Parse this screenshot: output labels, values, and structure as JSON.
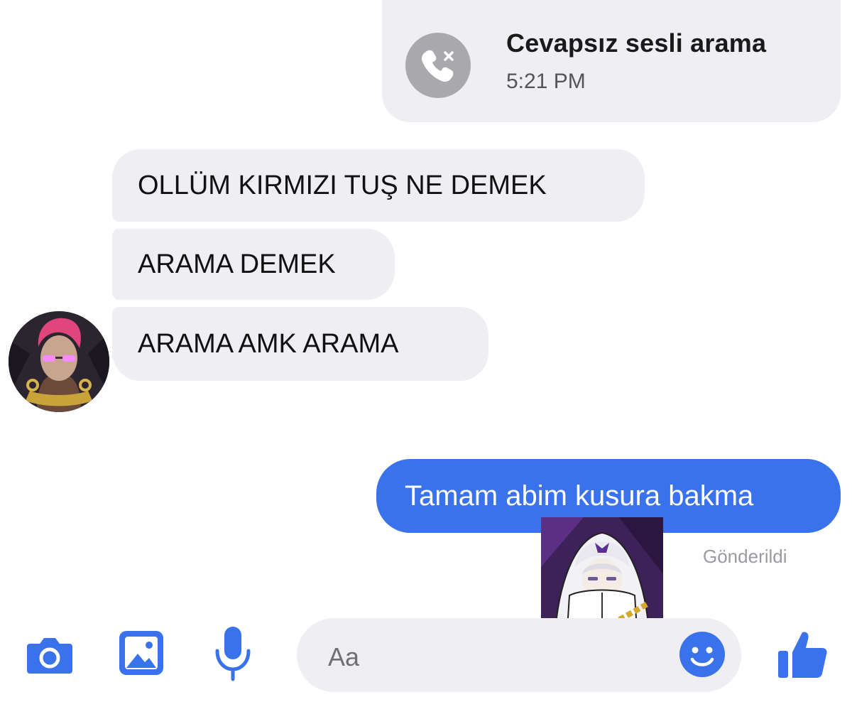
{
  "missed_call": {
    "title": "Cevapsız sesli arama",
    "time": "5:21 PM",
    "icon": "phone-missed-icon"
  },
  "incoming_messages": [
    "OLLÜM KIRMIZI TUŞ NE DEMEK",
    "ARAMA DEMEK",
    "ARAMA AMK ARAMA"
  ],
  "outgoing_message": "Tamam abim kusura bakma",
  "delivery_status": "Gönderildi",
  "composer": {
    "placeholder": "Aa",
    "icons": [
      "camera-icon",
      "image-icon",
      "microphone-icon",
      "emoji-icon",
      "thumbs-up-icon"
    ]
  },
  "colors": {
    "accent": "#3a72ec",
    "incoming_bubble": "#eeeef3",
    "icon_gray": "#a8a8ad",
    "secondary_text": "#9a9aa0"
  }
}
